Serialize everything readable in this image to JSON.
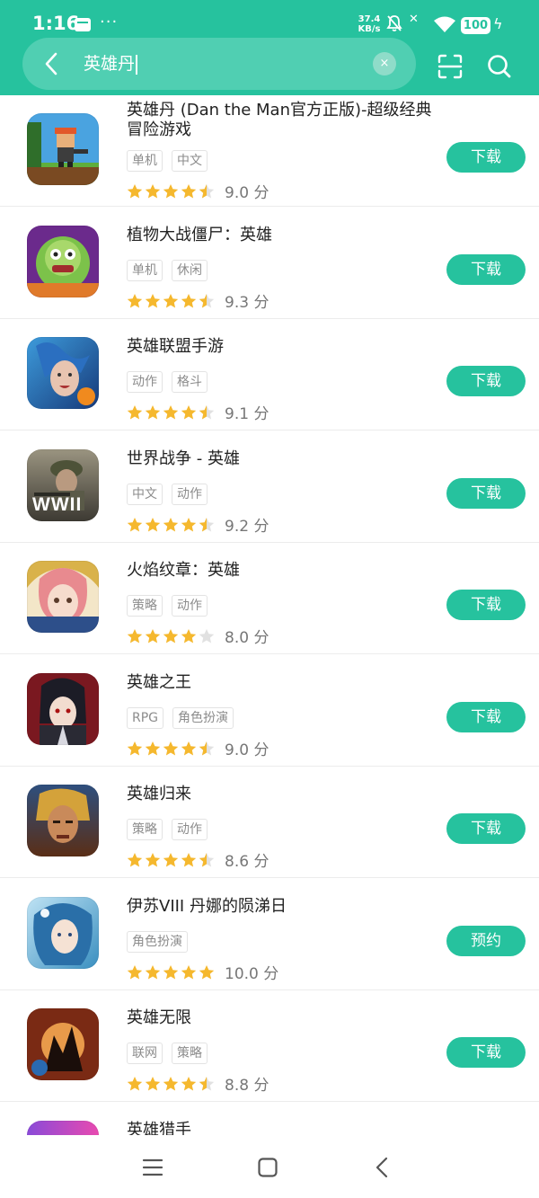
{
  "status": {
    "time": "1:16",
    "dots": "···",
    "speed_value": "37.4",
    "speed_unit": "KB/s",
    "battery": "100"
  },
  "search": {
    "query": "英雄丹",
    "clear_symbol": "×"
  },
  "colors": {
    "accent": "#26c29e",
    "star_filled": "#f5b82e",
    "star_empty": "#e1e1e1"
  },
  "apps": [
    {
      "name": "英雄丹 (Dan the Man官方正版)-超级经典冒险游戏",
      "tags": [
        "单机",
        "中文"
      ],
      "rating": 4.5,
      "score": "9.0 分",
      "action": "下载"
    },
    {
      "name": "植物大战僵尸：英雄",
      "tags": [
        "单机",
        "休闲"
      ],
      "rating": 4.5,
      "score": "9.3 分",
      "action": "下载"
    },
    {
      "name": "英雄联盟手游",
      "tags": [
        "动作",
        "格斗"
      ],
      "rating": 4.5,
      "score": "9.1 分",
      "action": "下载"
    },
    {
      "name": "世界战争 - 英雄",
      "tags": [
        "中文",
        "动作"
      ],
      "rating": 4.5,
      "score": "9.2 分",
      "action": "下载",
      "icon_text": "WWII"
    },
    {
      "name": "火焰纹章：英雄",
      "tags": [
        "策略",
        "动作"
      ],
      "rating": 4,
      "score": "8.0 分",
      "action": "下载"
    },
    {
      "name": "英雄之王",
      "tags": [
        "RPG",
        "角色扮演"
      ],
      "rating": 4.5,
      "score": "9.0 分",
      "action": "下载"
    },
    {
      "name": "英雄归来",
      "tags": [
        "策略",
        "动作"
      ],
      "rating": 4.5,
      "score": "8.6 分",
      "action": "下载"
    },
    {
      "name": "伊苏VIII 丹娜的陨涕日",
      "tags": [
        "角色扮演"
      ],
      "rating": 5,
      "score": "10.0 分",
      "action": "预约"
    },
    {
      "name": "英雄无限",
      "tags": [
        "联网",
        "策略"
      ],
      "rating": 4.5,
      "score": "8.8 分",
      "action": "下载"
    },
    {
      "name": "英雄猎手",
      "tags": [],
      "rating": 0,
      "score": "",
      "action": ""
    }
  ]
}
